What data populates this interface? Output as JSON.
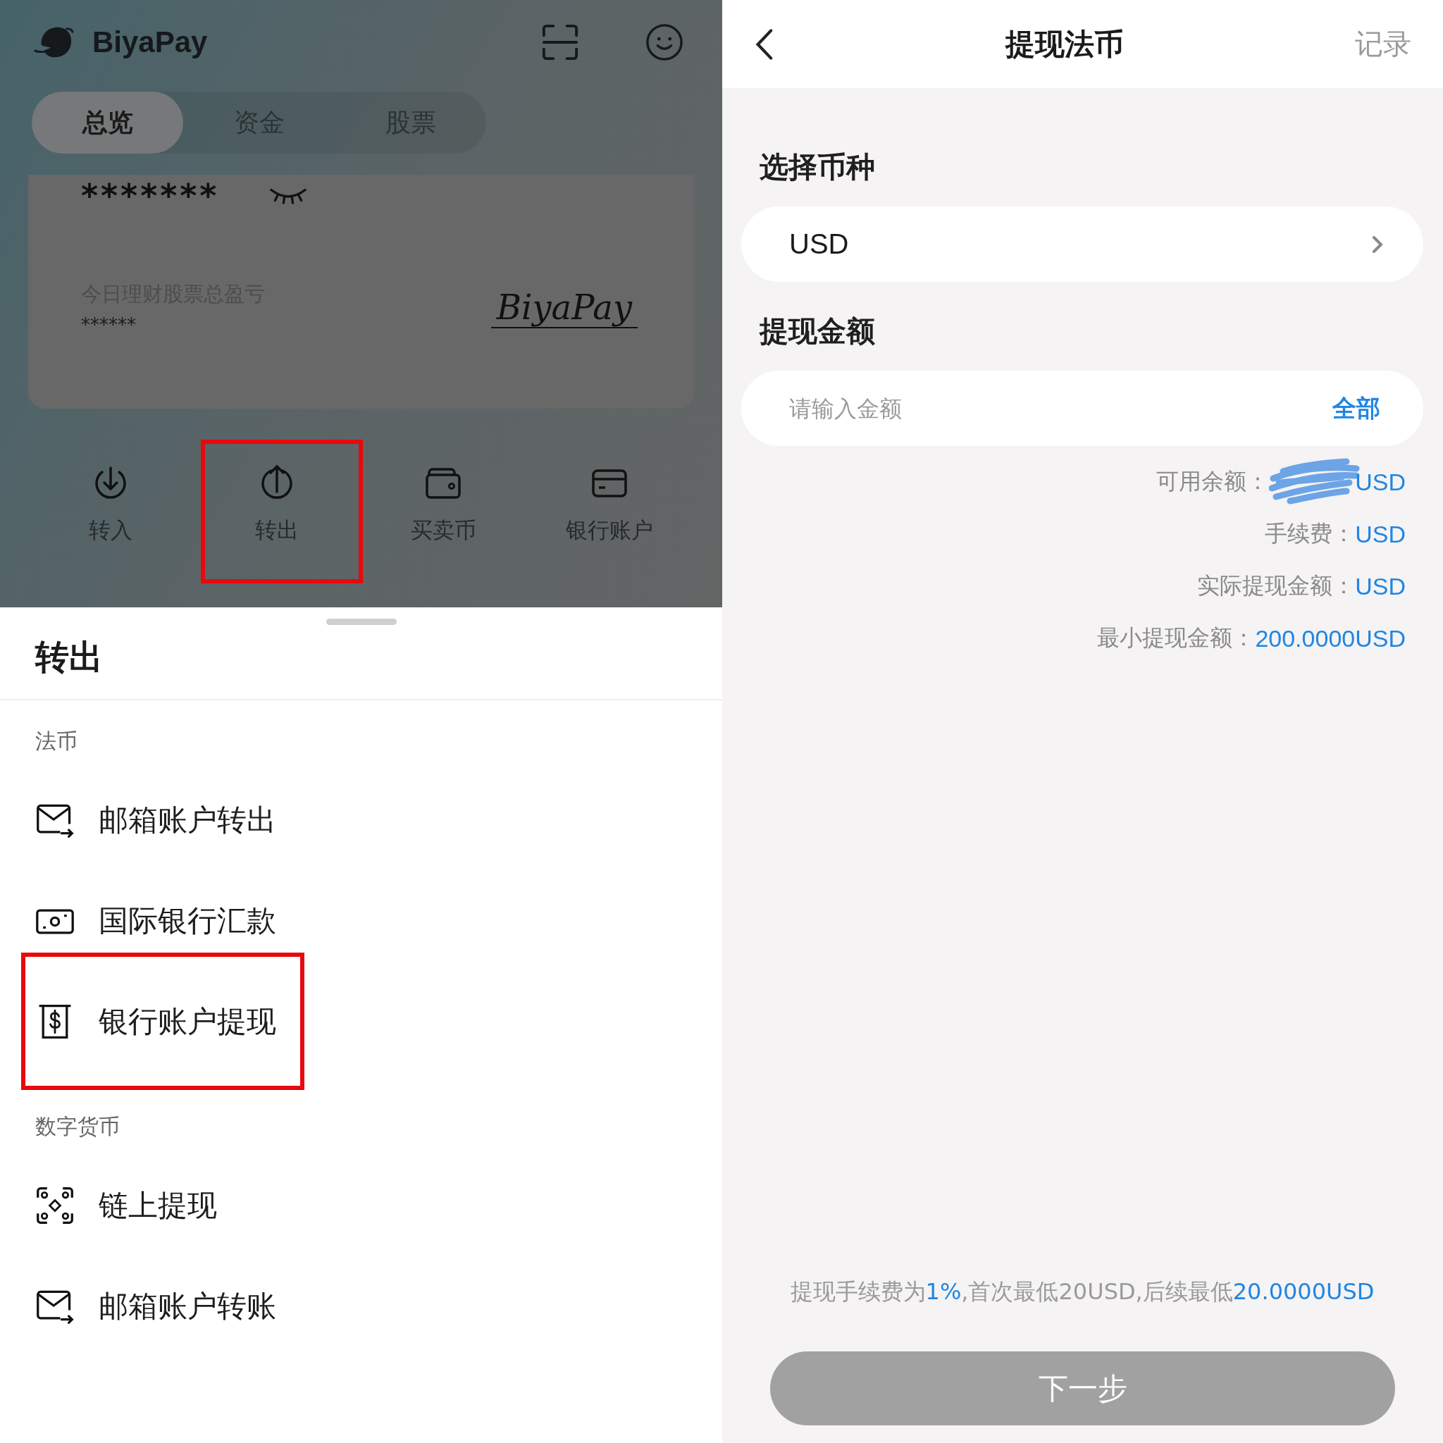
{
  "home": {
    "brand": "BiyaPay",
    "tabs": [
      {
        "label": "总览",
        "selected": true
      },
      {
        "label": "资金",
        "selected": false
      },
      {
        "label": "股票",
        "selected": false
      }
    ],
    "card": {
      "balance": "*******",
      "pnl_label": "今日理财股票总盈亏",
      "pnl_value": "******",
      "signature": "BiyaPay"
    },
    "actions": [
      {
        "label": "转入",
        "kind": "in",
        "highlighted": false
      },
      {
        "label": "转出",
        "kind": "out",
        "highlighted": true
      },
      {
        "label": "买卖币",
        "kind": "wallet",
        "highlighted": false
      },
      {
        "label": "银行账户",
        "kind": "card",
        "highlighted": false
      }
    ]
  },
  "sheet": {
    "title": "转出",
    "sections": [
      {
        "title": "法币",
        "items": [
          {
            "label": "邮箱账户转出",
            "kind": "mail",
            "highlighted": false
          },
          {
            "label": "国际银行汇款",
            "kind": "cash",
            "highlighted": false
          },
          {
            "label": "银行账户提现",
            "kind": "dollar",
            "highlighted": true
          }
        ]
      },
      {
        "title": "数字货币",
        "items": [
          {
            "label": "链上提现",
            "kind": "chain",
            "highlighted": false
          },
          {
            "label": "邮箱账户转账",
            "kind": "mail",
            "highlighted": false
          }
        ]
      }
    ]
  },
  "withdraw": {
    "title": "提现法币",
    "records_link": "记录",
    "currency_label": "选择币种",
    "currency": "USD",
    "amount_label": "提现金额",
    "amount_placeholder": "请输入金额",
    "all_button": "全部",
    "details": [
      {
        "label": "可用余额：",
        "value": "USD",
        "redacted": true
      },
      {
        "label": "手续费：",
        "value": "USD",
        "redacted": false
      },
      {
        "label": "实际提现金额：",
        "value": "USD",
        "redacted": false
      },
      {
        "label": "最小提现金额：",
        "value": "200.0000USD",
        "redacted": false
      }
    ],
    "note": [
      {
        "text": "提现手续费为",
        "highlight": false
      },
      {
        "text": "1%",
        "highlight": true
      },
      {
        "text": ",首次最低20USD,后续最低",
        "highlight": false
      },
      {
        "text": "20.0000USD",
        "highlight": true
      }
    ],
    "next_button": "下一步"
  }
}
